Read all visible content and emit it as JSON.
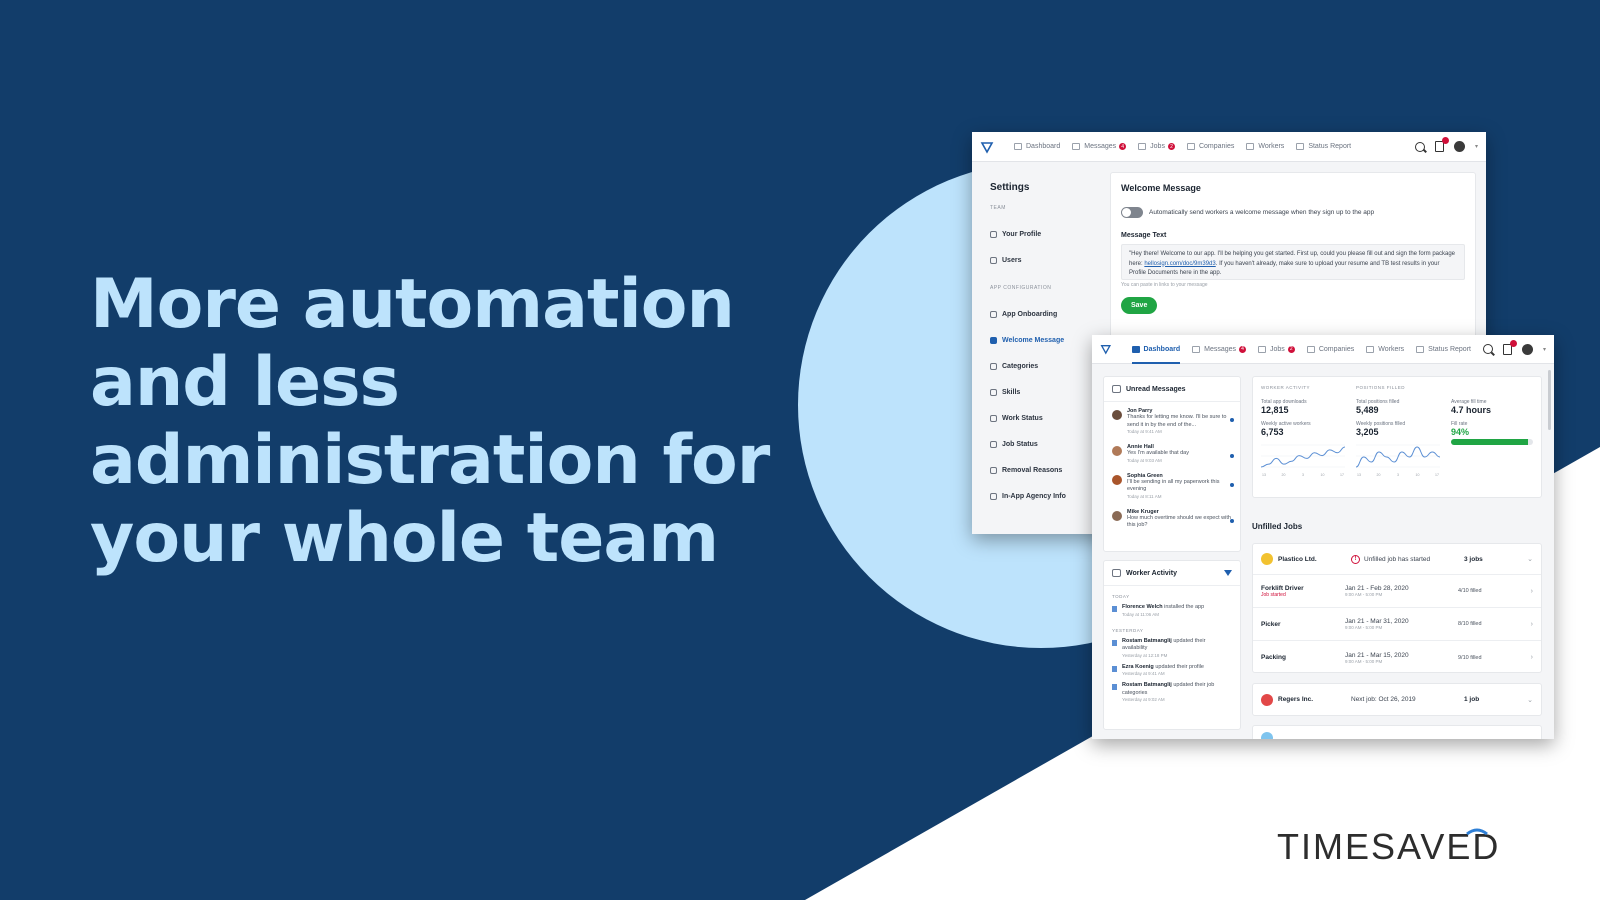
{
  "headline": [
    "More automation",
    "and less",
    "administration for",
    "your whole team"
  ],
  "logo": {
    "text": "TIMESAVED"
  },
  "colors": {
    "navy": "#123d6a",
    "light_blue": "#bde3fc",
    "accent_blue": "#1f5fae",
    "green": "#20a544",
    "red_badge": "#d0103a"
  },
  "settings_window": {
    "nav": [
      {
        "label": "Dashboard",
        "icon": "home-icon"
      },
      {
        "label": "Messages",
        "icon": "chat-icon",
        "badge": "4"
      },
      {
        "label": "Jobs",
        "icon": "briefcase-icon",
        "badge": "2"
      },
      {
        "label": "Companies",
        "icon": "building-icon"
      },
      {
        "label": "Workers",
        "icon": "people-icon"
      },
      {
        "label": "Status Report",
        "icon": "report-icon"
      }
    ],
    "sidebar": {
      "title": "Settings",
      "team_section": "TEAM",
      "team_items": [
        "Your Profile",
        "Users"
      ],
      "app_section": "APP CONFIGURATION",
      "app_items": [
        "App Onboarding",
        "Welcome Message",
        "Categories",
        "Skills",
        "Work Status",
        "Job Status",
        "Removal Reasons",
        "In-App Agency Info"
      ],
      "active": "Welcome Message"
    },
    "welcome": {
      "title": "Welcome Message",
      "toggle_label": "Automatically send workers a welcome message when they sign up to the app",
      "toggle_on": false,
      "message_label": "Message Text",
      "message_part1": "\"Hey there! Welcome to our app. I'll be helping you get started. First up, could you please fill out and sign the form package here: ",
      "message_link": "hellosign.com/doc/9m39d3",
      "message_part2": ". If you haven't already, make sure to upload your resume and TB test results in your Profile Documents here in the app.",
      "hint": "You can paste in links to your message",
      "save_label": "Save"
    }
  },
  "dashboard_window": {
    "nav": [
      {
        "label": "Dashboard",
        "active": true
      },
      {
        "label": "Messages",
        "badge": "4"
      },
      {
        "label": "Jobs",
        "badge": "2"
      },
      {
        "label": "Companies"
      },
      {
        "label": "Workers"
      },
      {
        "label": "Status Report"
      }
    ],
    "unread": {
      "title": "Unread Messages",
      "messages": [
        {
          "name": "Jon Parry",
          "text": "Thanks for letting me know. I'll be sure to send it in by the end of the...",
          "time": "Today at 9:41 AM",
          "color": "#6a4d3c"
        },
        {
          "name": "Annie Hall",
          "text": "Yes I'm available that day",
          "time": "Today at 9:03 AM",
          "color": "#b07a58"
        },
        {
          "name": "Sophia Green",
          "text": "I'll be sending in all my paperwork this evening",
          "time": "Today at 8:11 AM",
          "color": "#a9552b"
        },
        {
          "name": "Mike Kruger",
          "text": "How much overtime should we expect with this job?",
          "time": "",
          "color": "#8a6a55"
        }
      ]
    },
    "worker_activity": {
      "title": "Worker Activity",
      "today_label": "TODAY",
      "today": [
        {
          "name": "Florence Welch",
          "action": "installed the app",
          "time": "Today at 11:06 AM"
        }
      ],
      "yesterday_label": "YESTERDAY",
      "yesterday": [
        {
          "name": "Rostam Batmanglij",
          "action": "updated their availability",
          "time": "Yesterday at 12:18 PM"
        },
        {
          "name": "Ezra Koenig",
          "action": "updated their profile",
          "time": "Yesterday at 9:41 AM"
        },
        {
          "name": "Rostam Batmanglij",
          "action": "updated their job categories",
          "time": "Yesterday at 9:02 AM"
        }
      ]
    },
    "stats": {
      "worker_activity_label": "WORKER ACTIVITY",
      "positions_filled_label": "POSITIONS FILLED",
      "downloads_label": "Total app downloads",
      "downloads": "12,815",
      "weekly_active_label": "Weekly active workers",
      "weekly_active": "6,753",
      "total_filled_label": "Total positions filled",
      "total_filled": "5,489",
      "weekly_filled_label": "Weekly positions filled",
      "weekly_filled": "3,205",
      "avg_fill_label": "Average fill time",
      "avg_fill": "4.7 hours",
      "fill_rate_label": "Fill rate",
      "fill_rate": "94%",
      "fill_rate_fraction": 0.94,
      "spark_ticks": [
        "13",
        "20",
        "3",
        "10",
        "17"
      ],
      "spark_values_a": [
        2,
        3,
        5,
        3,
        4,
        6,
        5,
        7,
        6,
        8,
        7,
        9
      ],
      "spark_values_b": [
        3,
        5,
        4,
        6,
        5,
        4,
        6,
        5,
        7,
        5,
        6,
        5
      ]
    },
    "unfilled": {
      "title": "Unfilled Jobs",
      "companies": [
        {
          "name": "Plastico Ltd.",
          "color": "#f2c230",
          "status": "Unfilled job has started",
          "count": "3 jobs",
          "jobs": [
            {
              "name": "Forklift Driver",
              "sub": "Job started",
              "dates": "Jan 21 - Feb 28, 2020",
              "time": "9:00 AM - 5:00 PM",
              "filled": "4/10 filled"
            },
            {
              "name": "Picker",
              "sub": "",
              "dates": "Jan 21 - Mar 31, 2020",
              "time": "9:00 AM - 5:00 PM",
              "filled": "8/10 filled"
            },
            {
              "name": "Packing",
              "sub": "",
              "dates": "Jan 21 - Mar 15, 2020",
              "time": "9:00 AM - 5:00 PM",
              "filled": "9/10 filled"
            }
          ]
        },
        {
          "name": "Regers Inc.",
          "color": "#e24848",
          "status": "Next job: Oct 26, 2019",
          "count": "1 job",
          "jobs": []
        }
      ]
    }
  }
}
